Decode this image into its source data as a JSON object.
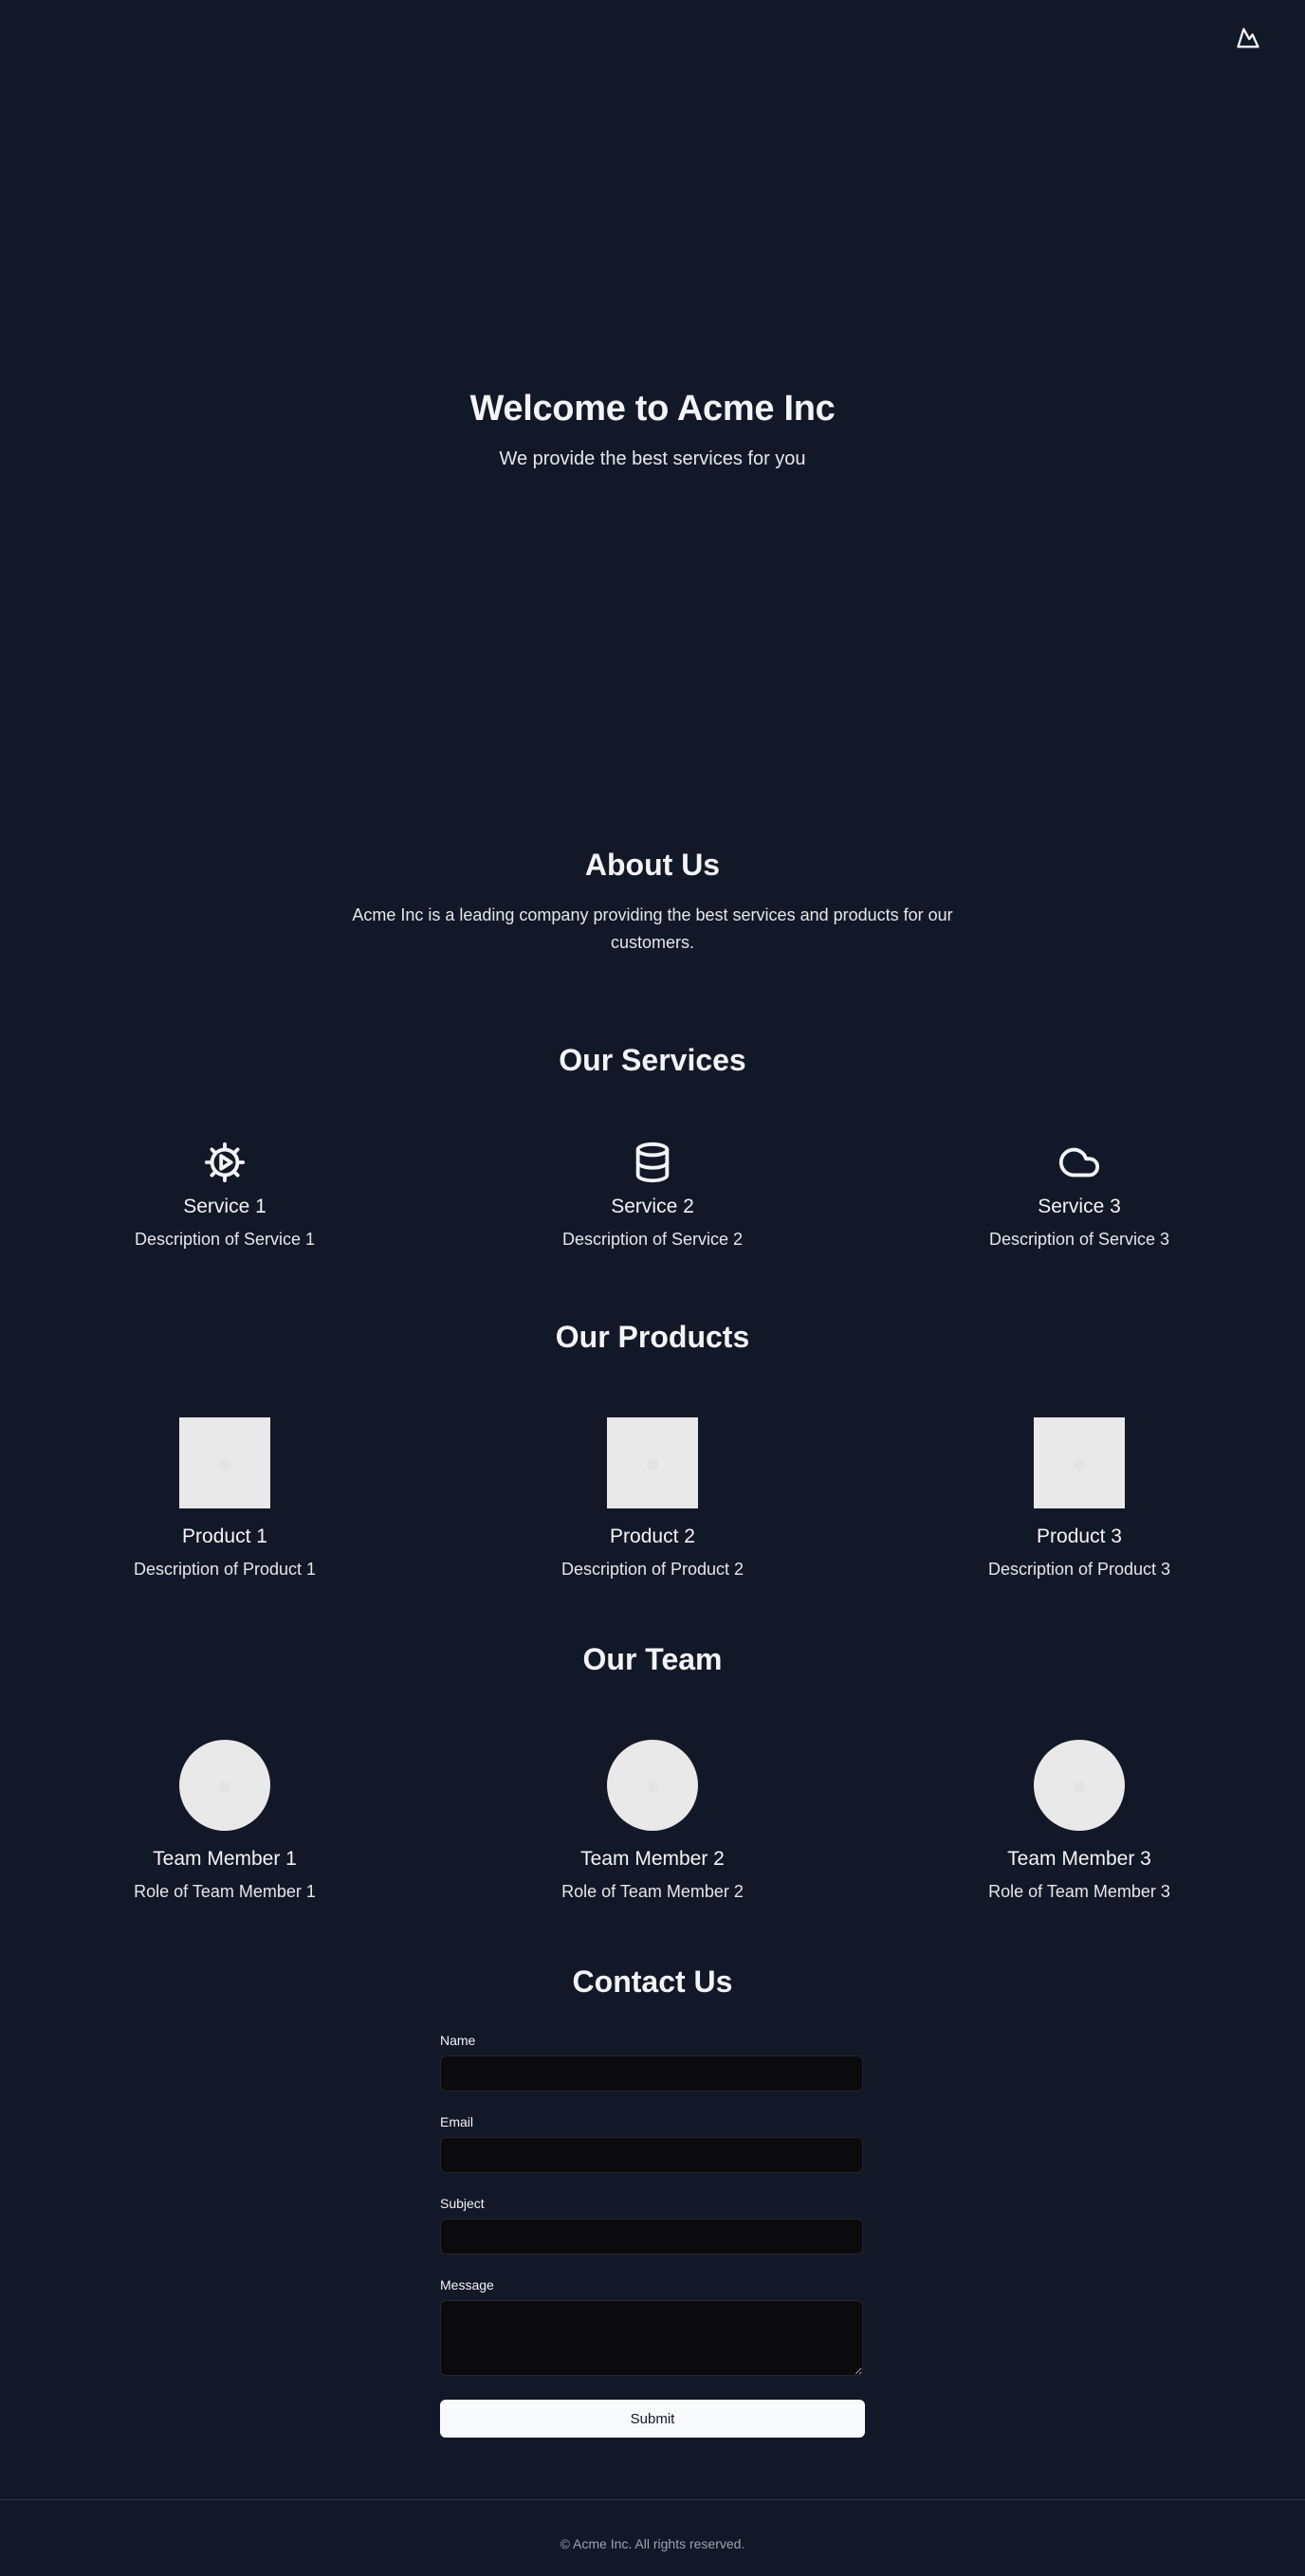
{
  "header": {
    "logo_icon": "mountain-icon"
  },
  "hero": {
    "title": "Welcome to Acme Inc",
    "subtitle": "We provide the best services for you"
  },
  "about": {
    "title": "About Us",
    "text": "Acme Inc is a leading company providing the best services and products for our customers."
  },
  "services": {
    "title": "Our Services",
    "items": [
      {
        "icon": "gear-play-icon",
        "title": "Service 1",
        "desc": "Description of Service 1"
      },
      {
        "icon": "database-icon",
        "title": "Service 2",
        "desc": "Description of Service 2"
      },
      {
        "icon": "cloud-icon",
        "title": "Service 3",
        "desc": "Description of Service 3"
      }
    ]
  },
  "products": {
    "title": "Our Products",
    "items": [
      {
        "title": "Product 1",
        "desc": "Description of Product 1"
      },
      {
        "title": "Product 2",
        "desc": "Description of Product 2"
      },
      {
        "title": "Product 3",
        "desc": "Description of Product 3"
      }
    ]
  },
  "team": {
    "title": "Our Team",
    "items": [
      {
        "name": "Team Member 1",
        "role": "Role of Team Member 1"
      },
      {
        "name": "Team Member 2",
        "role": "Role of Team Member 2"
      },
      {
        "name": "Team Member 3",
        "role": "Role of Team Member 3"
      }
    ]
  },
  "contact": {
    "title": "Contact Us",
    "fields": {
      "name": "Name",
      "email": "Email",
      "subject": "Subject",
      "message": "Message"
    },
    "submit": "Submit"
  },
  "footer": {
    "text": "© Acme Inc. All rights reserved."
  }
}
